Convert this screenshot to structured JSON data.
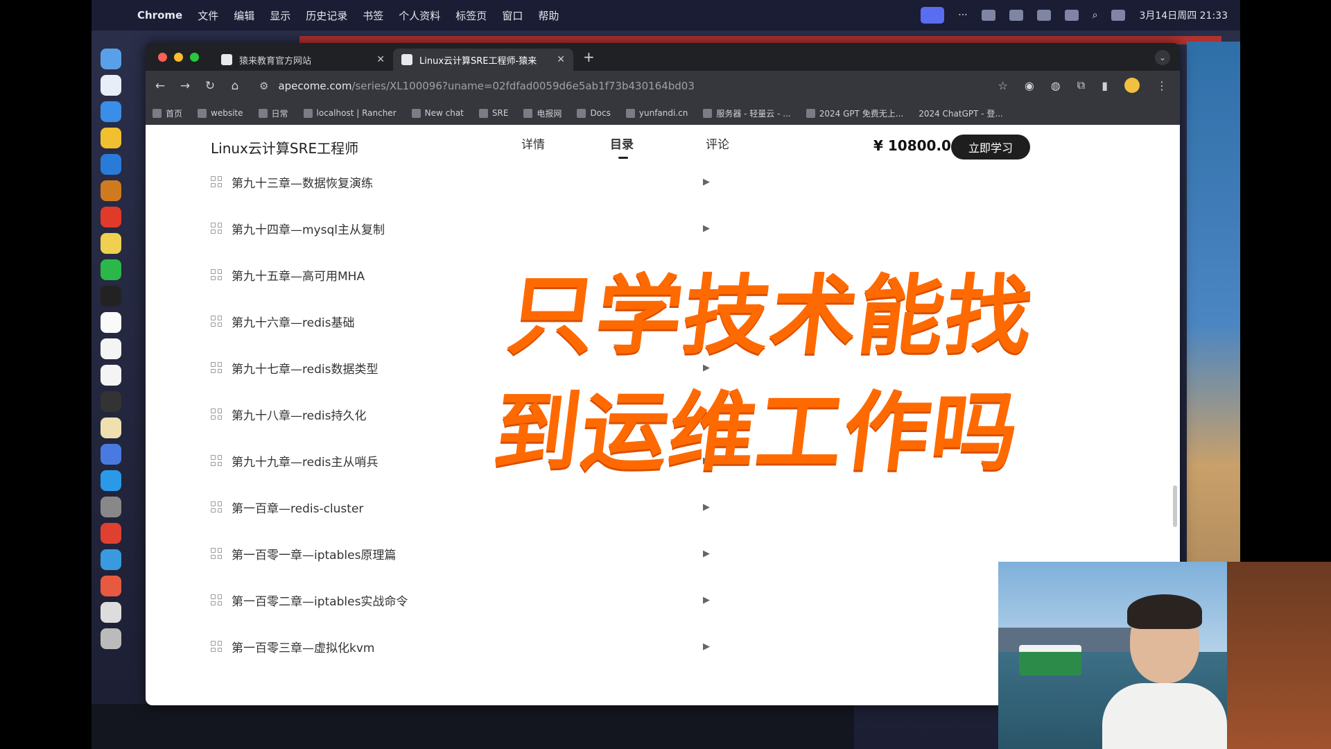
{
  "menubar": {
    "app_name": "Chrome",
    "menus": [
      "文件",
      "编辑",
      "显示",
      "历史记录",
      "书签",
      "个人资料",
      "标签页",
      "窗口",
      "帮助"
    ],
    "datetime": "3月14日周四 21:33"
  },
  "tabs": [
    {
      "title": "猿来教育官方网站",
      "active": false
    },
    {
      "title": "Linux云计算SRE工程师-猿来",
      "active": true
    }
  ],
  "address": {
    "host": "apecome.com",
    "path": "/series/XL100096?uname=02fdfad0059d6e5ab1f73b430164bd03"
  },
  "bookmarks": [
    "首页",
    "website",
    "日常",
    "localhost | Rancher",
    "New chat",
    "SRE",
    "电报网",
    "Docs",
    "yunfandi.cn",
    "服务器 - 轻量云 - ...",
    "2024 GPT 免费无上...",
    "2024 ChatGPT - 登..."
  ],
  "course": {
    "title": "Linux云计算SRE工程师",
    "tabs": [
      "详情",
      "目录",
      "评论"
    ],
    "active_tab": "目录",
    "price": "¥ 10800.00",
    "buy_label": "立即学习"
  },
  "chapters": [
    "第九十三章—数据恢复演练",
    "第九十四章—mysql主从复制",
    "第九十五章—高可用MHA",
    "第九十六章—redis基础",
    "第九十七章—redis数据类型",
    "第九十八章—redis持久化",
    "第九十九章—redis主从哨兵",
    "第一百章—redis-cluster",
    "第一百零一章—iptables原理篇",
    "第一百零二章—iptables实战命令",
    "第一百零三章—虚拟化kvm"
  ],
  "overlay": {
    "line1": "只学技术能找",
    "line2": "到运维工作吗",
    "color": "#ff6a00"
  },
  "colors": {
    "menubar": "#1a1d33",
    "browser_chrome": "#35373c",
    "buy_button": "#1e1e1e"
  }
}
